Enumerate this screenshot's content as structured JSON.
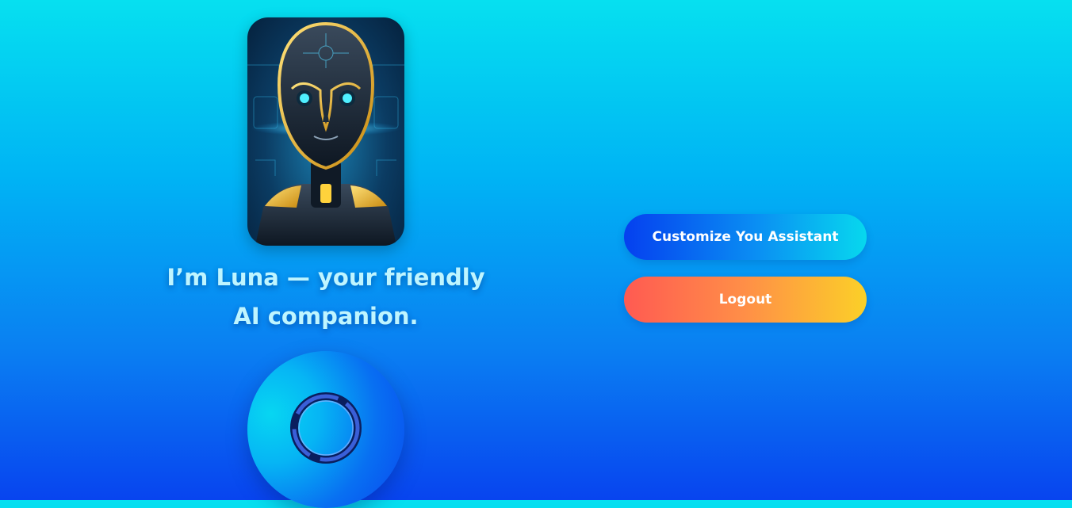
{
  "assistant": {
    "name": "Luna",
    "tagline_line1": "I’m Luna — your friendly",
    "tagline_line2": "AI companion.",
    "avatar_icon": "robot-portrait"
  },
  "actions": {
    "customize_label": "Customize You Assistant",
    "logout_label": "Logout"
  },
  "mic": {
    "icon": "voice-ring-icon"
  },
  "colors": {
    "background_top": "#06e0f0",
    "background_bottom": "#0844ef",
    "tagline_text": "#bff5ff",
    "customize_gradient": [
      "#0540ef",
      "#07d8ee"
    ],
    "logout_gradient": [
      "#ff5a52",
      "#fbd028"
    ]
  }
}
